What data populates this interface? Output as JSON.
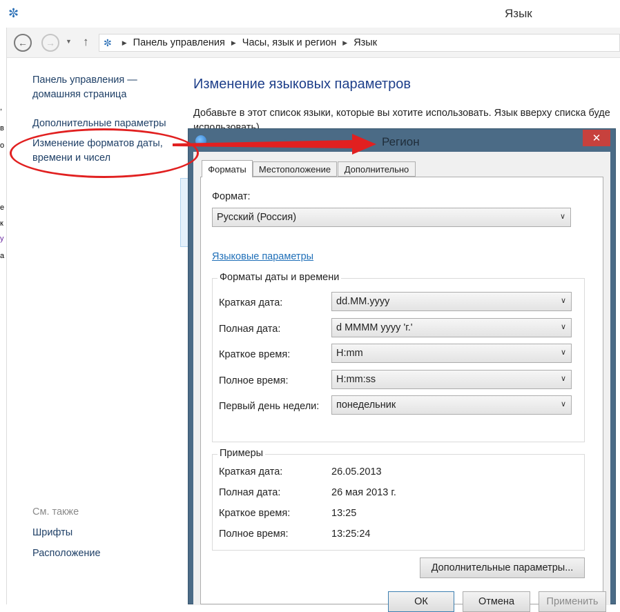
{
  "window": {
    "title": "Язык"
  },
  "addressbar": {
    "breadcrumbs": [
      "Панель управления",
      "Часы, язык и регион",
      "Язык"
    ]
  },
  "sidebar": {
    "home_link": "Панель управления — домашняя страница",
    "advanced_link": "Дополнительные параметры",
    "formats_link": "Изменение форматов даты, времени и чисел",
    "see_also": "См. также",
    "fonts_link": "Шрифты",
    "location_link": "Расположение"
  },
  "main": {
    "heading": "Изменение языковых параметров",
    "description": "Добавьте в этот список языки, которые вы хотите использовать. Язык вверху списка буде",
    "description_line2": "использовать)"
  },
  "dialog": {
    "title": "Регион",
    "close": "✕",
    "tabs": [
      "Форматы",
      "Местоположение",
      "Дополнительно"
    ],
    "format_label": "Формат:",
    "format_value": "Русский (Россия)",
    "language_link": "Языковые параметры",
    "formats_group": {
      "caption": "Форматы даты и времени",
      "rows": [
        {
          "label": "Краткая дата:",
          "value": "dd.MM.yyyy"
        },
        {
          "label": "Полная дата:",
          "value": "d MMMM yyyy 'г.'"
        },
        {
          "label": "Краткое время:",
          "value": "H:mm"
        },
        {
          "label": "Полное время:",
          "value": "H:mm:ss"
        },
        {
          "label": "Первый день недели:",
          "value": "понедельник"
        }
      ]
    },
    "examples_group": {
      "caption": "Примеры",
      "rows": [
        {
          "label": "Краткая дата:",
          "value": "26.05.2013"
        },
        {
          "label": "Полная дата:",
          "value": "26 мая 2013 г."
        },
        {
          "label": "Краткое время:",
          "value": "13:25"
        },
        {
          "label": "Полное время:",
          "value": "13:25:24"
        }
      ]
    },
    "additional_button": "Дополнительные параметры...",
    "ok_button": "ОК",
    "cancel_button": "Отмена",
    "apply_button": "Применить"
  },
  "colors": {
    "annotation_red": "#e12020",
    "dialog_frame": "#4b6b86",
    "link_blue": "#1f6fb8",
    "heading_blue": "#1e3f8a"
  }
}
